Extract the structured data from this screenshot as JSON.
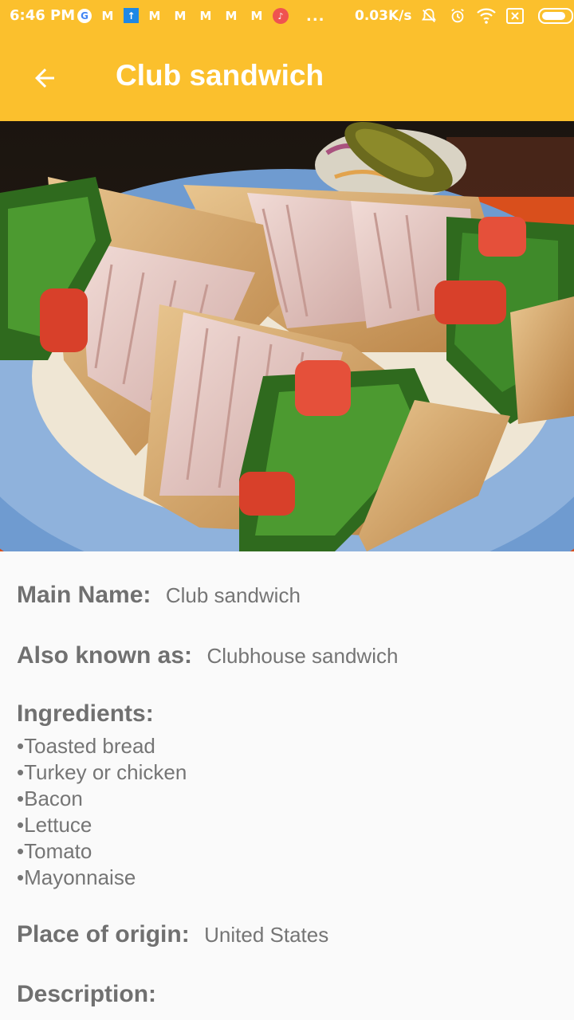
{
  "status_bar": {
    "time": "6:46 PM",
    "net_speed": "0.03K/s",
    "more": "...",
    "icons": [
      "google-icon",
      "gmail-icon",
      "upload-icon",
      "gmail-icon",
      "gmail-icon",
      "gmail-icon",
      "gmail-icon",
      "gmail-icon",
      "music-icon"
    ],
    "system_icons": [
      "alarm-muted-icon",
      "alarm-icon",
      "wifi-icon",
      "sim-none-icon",
      "battery-icon"
    ],
    "battery_level": 0.85
  },
  "app_bar": {
    "title": "Club sandwich",
    "back_icon": "arrow-left-icon",
    "color": "#fbc02d"
  },
  "details": {
    "main_name_label": "Main Name:",
    "main_name_value": "Club sandwich",
    "aka_label": "Also known as:",
    "aka_value": "Clubhouse sandwich",
    "ingredients_label": "Ingredients:",
    "ingredients": [
      "•Toasted bread",
      "•Turkey or chicken",
      "•Bacon",
      "•Lettuce",
      "•Tomato",
      "•Mayonnaise"
    ],
    "origin_label": "Place of origin:",
    "origin_value": "United States",
    "description_label": "Description:"
  }
}
